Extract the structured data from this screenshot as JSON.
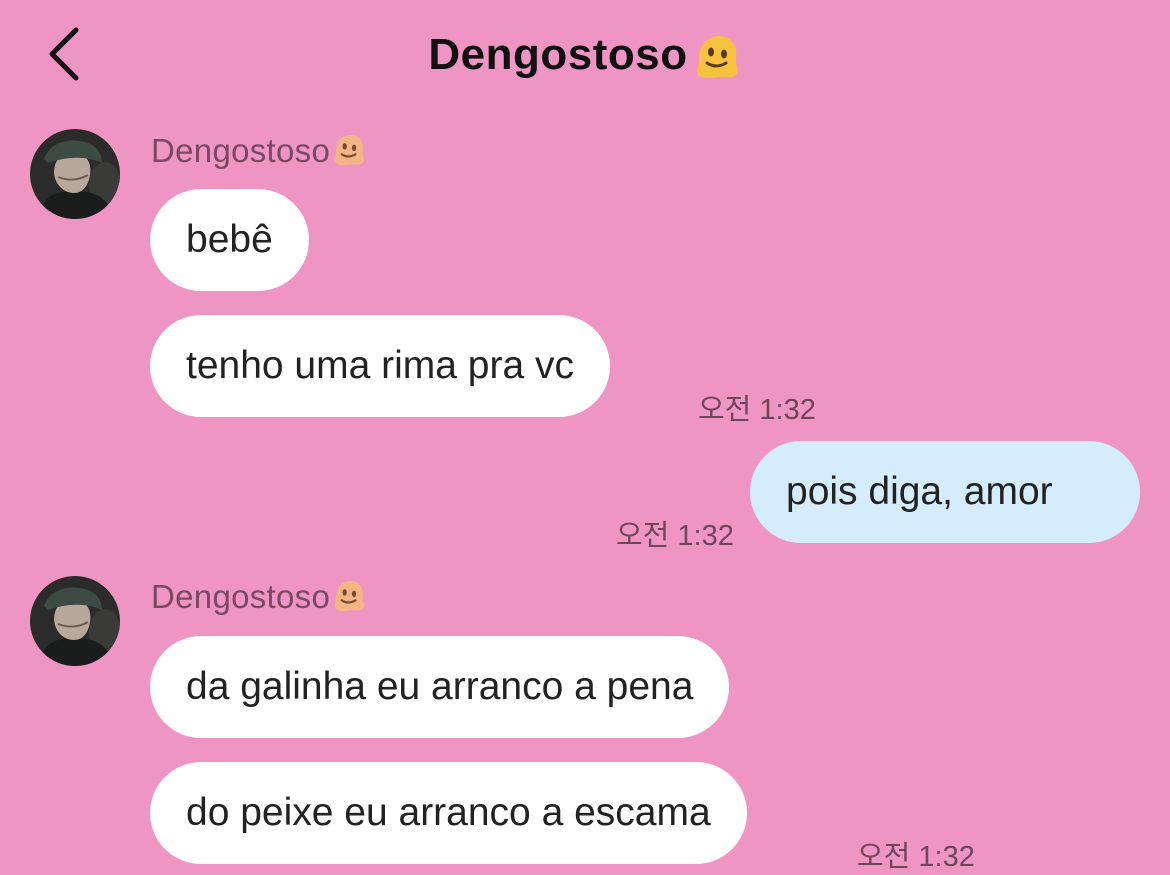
{
  "header": {
    "back_icon": "chevron-left-icon",
    "title": "Dengostoso",
    "title_emoji": "melting-face-icon"
  },
  "colors": {
    "background": "#ef95c3",
    "incoming_bubble": "#ffffff",
    "outgoing_bubble": "#d4ecfc",
    "timestamp": "#6e4659"
  },
  "messages": {
    "group1": {
      "sender": "Dengostoso",
      "m1": "bebê",
      "m2": "tenho uma rima pra vc",
      "time": "오전 1:32"
    },
    "outgoing": {
      "m1": "pois diga, amor",
      "time": "오전 1:32"
    },
    "group2": {
      "sender": "Dengostoso",
      "m1": "da galinha eu arranco a pena",
      "m2": "do peixe eu arranco a escama",
      "time": "오전 1:32"
    }
  }
}
